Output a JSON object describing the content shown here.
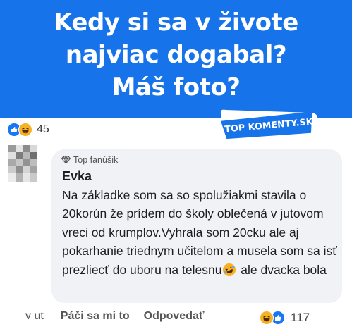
{
  "banner": {
    "line1": "Kedy si sa v živote",
    "line2": "najviac dogabal?",
    "line3": "Máš foto?"
  },
  "reactions": {
    "count": "45",
    "icons": [
      "like-icon",
      "haha-icon"
    ]
  },
  "badge": {
    "text": "TOP KOMENTY.SK",
    "color": "#1773ea"
  },
  "comment": {
    "fan_label": "Top fanúšik",
    "author": "Evka",
    "text": "Na základke som sa so spolužiakmi stavila o 20korún že prídem do školy oblečená v jutovom vreci od krumplov.Vyhrala som 20cku ale aj pokarhanie triednym učitelom a musela som sa isť prezliecť do uboru na telesnu",
    "text_end": " ale dvacka bola",
    "inline_emoji": "rofl-icon"
  },
  "actions": {
    "time": "v ut",
    "like_label": "Páči sa mi to",
    "reply_label": "Odpovedať",
    "reaction_count": "117"
  },
  "colors": {
    "brand_blue": "#1773ea",
    "like_blue": "#1877f2",
    "bubble_bg": "#f0f2f5"
  }
}
